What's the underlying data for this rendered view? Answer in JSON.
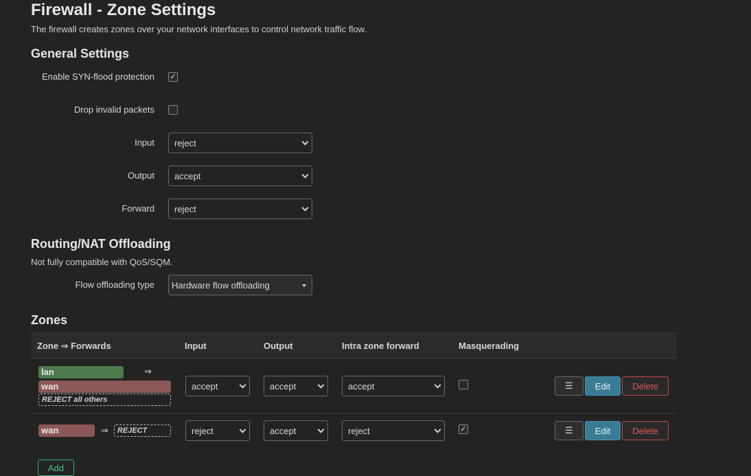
{
  "page": {
    "title": "Firewall - Zone Settings",
    "description": "The firewall creates zones over your network interfaces to control network traffic flow."
  },
  "general": {
    "title": "General Settings",
    "syn_flood": {
      "label": "Enable SYN-flood protection",
      "mark": "✓",
      "checked": true
    },
    "drop_invalid": {
      "label": "Drop invalid packets",
      "checked": false
    },
    "input": {
      "label": "Input",
      "value": "reject"
    },
    "output": {
      "label": "Output",
      "value": "accept"
    },
    "forward": {
      "label": "Forward",
      "value": "reject"
    }
  },
  "offloading": {
    "title": "Routing/NAT Offloading",
    "description": "Not fully compatible with QoS/SQM.",
    "type": {
      "label": "Flow offloading type",
      "value": "Hardware flow offloading"
    }
  },
  "zones": {
    "title": "Zones",
    "headers": {
      "zone_forwards": "Zone ⇒ Forwards",
      "input": "Input",
      "output": "Output",
      "intra": "Intra zone forward",
      "masq": "Masquerading"
    },
    "rows": [
      {
        "zone": "lan",
        "zone_color": "#4c7a4c",
        "arrow": "⇒",
        "forward_zone": "wan",
        "forward_color": "#8c5757",
        "policy": "REJECT all others",
        "input": "accept",
        "output": "accept",
        "intra": "accept",
        "masq": false,
        "masq_mark": ""
      },
      {
        "zone": "wan",
        "zone_color": "#8c5757",
        "arrow": "⇒",
        "policy": "REJECT",
        "input": "reject",
        "output": "accept",
        "intra": "reject",
        "masq": true,
        "masq_mark": "✓"
      }
    ],
    "buttons": {
      "menu": "☰",
      "edit": "Edit",
      "delete": "Delete"
    },
    "add_label": "Add"
  },
  "icons": {
    "menu": "hamburger-menu-icon",
    "dropdown": "chevron-down-icon",
    "check": "checkmark-icon"
  }
}
